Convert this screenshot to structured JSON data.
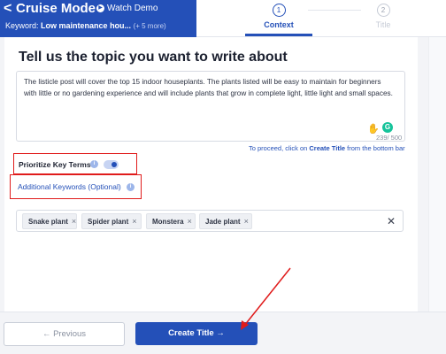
{
  "header": {
    "back_glyph": "<",
    "title": "Cruise Mode",
    "watch_demo": "Watch Demo",
    "keyword_prefix": "Keyword:",
    "keyword_value": "Low maintenance hou...",
    "keyword_more": "(+ 5 more)",
    "brand_color": "#2450b8"
  },
  "steps": [
    {
      "number": "1",
      "label": "Context",
      "active": true
    },
    {
      "number": "2",
      "label": "Title",
      "active": false
    }
  ],
  "main": {
    "heading": "Tell us the topic you want to write about",
    "topic_text": "The listicle post will cover the top 15 indoor houseplants. The plants listed will be easy to maintain for beginners with little or no gardening experience and will include plants that grow in complete light, little light and small spaces.",
    "counter": "239/ 500",
    "grammarly_glyph": "G",
    "proceed_prefix": "To proceed, click on ",
    "proceed_action": "Create Title",
    "proceed_suffix": " from the bottom bar",
    "prioritize_label": "Prioritize Key Terms",
    "prioritize_on": true,
    "additional_keywords_label": "Additional Keywords (Optional)",
    "info_glyph": "i",
    "chips": [
      "Snake plant",
      "Spider plant",
      "Monstera",
      "Jade plant"
    ],
    "chip_remove_glyph": "×",
    "clear_glyph": "✕"
  },
  "footer": {
    "previous_label": "← Previous",
    "create_label": "Create Title →"
  },
  "annotation_color": "#e01b1b"
}
